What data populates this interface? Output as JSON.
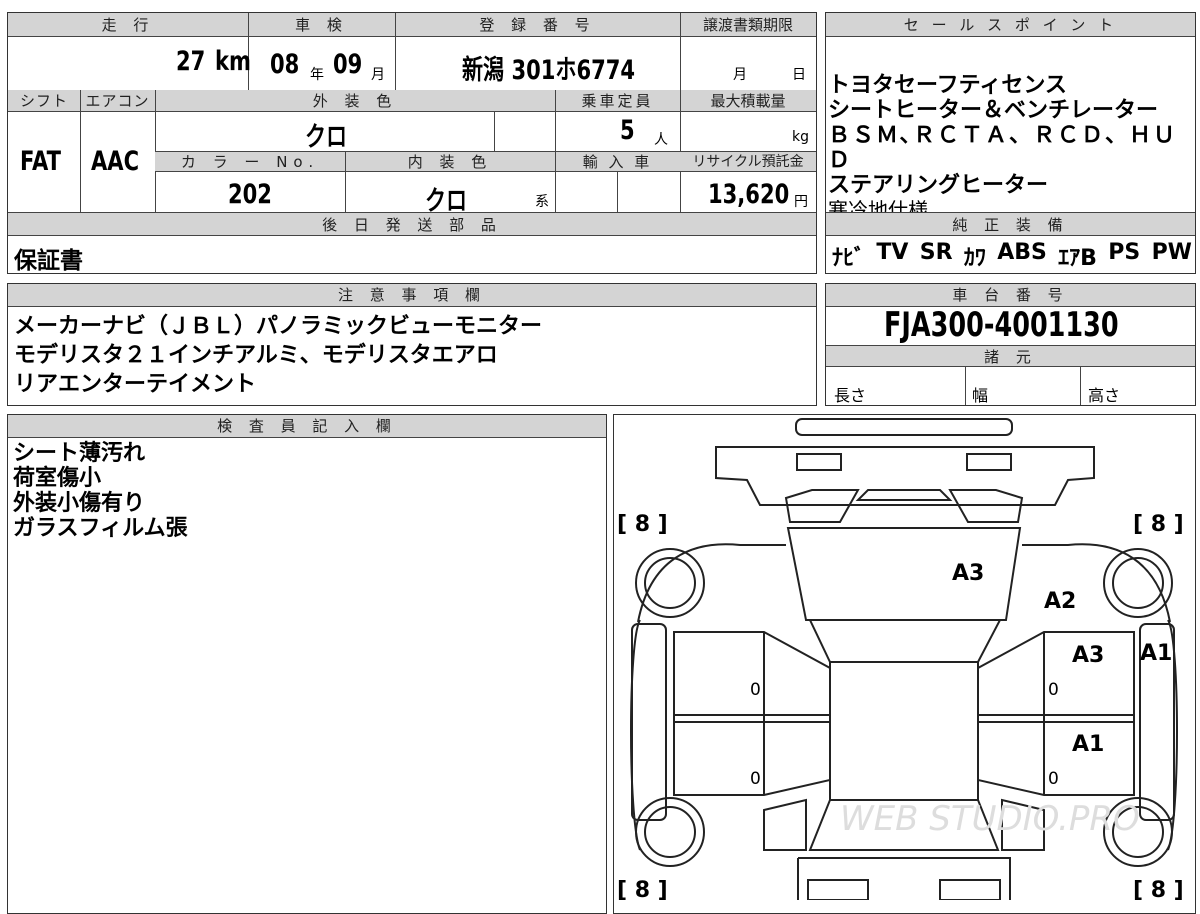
{
  "top_table": {
    "headers": {
      "mileage": "走 行",
      "inspection": "車 検",
      "registration": "登 録 番 号",
      "transfer_deadline": "譲渡書類期限",
      "shift": "シフト",
      "aircon": "エアコン",
      "exterior_color": "外 装 色",
      "capacity": "乗車定員",
      "max_load": "最大積載量",
      "color_no": "カ ラ ー No.",
      "interior_color": "内 装 色",
      "import": "輸 入 車",
      "recycle_fee": "リサイクル預託金",
      "parts_later": "後 日 発 送 部 品"
    },
    "mileage": "27",
    "mileage_unit": "km",
    "inspection_year": "08",
    "year_unit": "年",
    "inspection_month": "09",
    "month_unit": "月",
    "registration_number": "新潟 301ホ6774",
    "deadline_month_unit": "月",
    "deadline_day_unit": "日",
    "shift": "FAT",
    "aircon": "AAC",
    "exterior_color": "クロ",
    "capacity": "5",
    "capacity_unit": "人",
    "max_load_unit": "kg",
    "color_no": "202",
    "interior_color": "クロ",
    "interior_suffix": "系",
    "recycle_fee": "13,620",
    "recycle_unit": "円",
    "parts_later": "保証書"
  },
  "sales_points": {
    "header": "セ ー ル ス ポ イ ン ト",
    "lines": [
      "トヨタセーフティセンス",
      "シートヒーター＆ベンチレーター",
      "ＢＳＭ､ＲＣＴＡ、ＲＣＤ、ＨＵＤ",
      "ステアリングヒーター",
      "寒冷地仕様"
    ]
  },
  "genuine_equipment": {
    "header": "純 正 装 備",
    "items": [
      "ﾅﾋﾞ",
      "TV",
      "SR",
      "ｶﾜ",
      "ABS",
      "ｴｱB",
      "PS",
      "PW"
    ]
  },
  "notes": {
    "header": "注 意 事 項 欄",
    "lines": [
      "メーカーナビ（ＪＢＬ）パノラミックビューモニター",
      "モデリスタ２１インチアルミ、モデリスタエアロ",
      "リアエンターテイメント"
    ]
  },
  "chassis": {
    "header": "車 台 番 号",
    "number": "FJA300-4001130"
  },
  "specs": {
    "header": "諸 元",
    "length": "長さ",
    "width": "幅",
    "height": "高さ"
  },
  "inspector": {
    "header": "検 査 員 記 入 欄",
    "lines": [
      "シート薄汚れ",
      "荷室傷小",
      "外装小傷有り",
      "ガラスフィルム張"
    ]
  },
  "diagram": {
    "tire_depths": [
      "[ 8 ]",
      "[ 8 ]",
      "[ 8 ]",
      "[ 8 ]"
    ],
    "damage_marks": [
      "A3",
      "A2",
      "A3",
      "A1",
      "A1"
    ],
    "zero_marks": [
      "0",
      "0",
      "0",
      "0"
    ],
    "watermark": "WEB STUDIO.PRO"
  }
}
